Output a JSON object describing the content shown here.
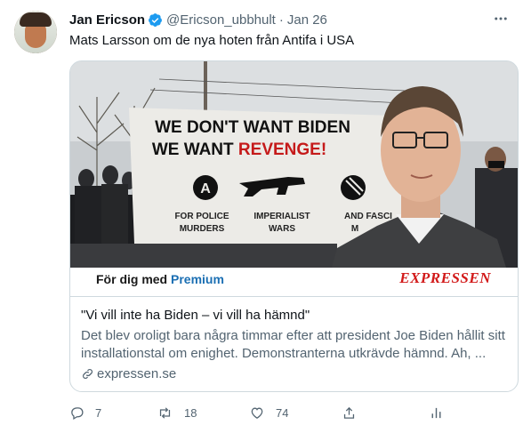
{
  "author": {
    "name": "Jan Ericson",
    "handle": "@Ericson_ubbhult",
    "separator": "·",
    "time": "Jan 26"
  },
  "tweet": {
    "text": "Mats Larsson om de nya hoten från Antifa i USA"
  },
  "card": {
    "image": {
      "banner_line1": "WE DON'T WANT BIDEN",
      "banner_line2_prefix": "WE WANT ",
      "banner_line2_highlight": "REVENGE!",
      "banner_col1_a": "FOR POLICE",
      "banner_col1_b": "MURDERS",
      "banner_col2_a": "IMPERIALIST",
      "banner_col2_b": "WARS",
      "banner_col3_a": "AND FASCI",
      "banner_col3_b": "M"
    },
    "premium_prefix": "För dig med ",
    "premium_word": "Premium",
    "brand": "EXPRESSEN",
    "title": "\"Vi vill inte ha Biden – vi vill ha hämnd\"",
    "description": "Det blev oroligt bara några timmar efter att president Joe Biden hållit sitt installationstal om enighet. Demonstranterna utkrävde hämnd. Ah, ...",
    "domain": "expressen.se"
  },
  "actions": {
    "replies": "7",
    "retweets": "18",
    "likes": "74"
  },
  "colors": {
    "accent": "#1d9bf0",
    "secondary_text": "#536471",
    "border": "#cfd9de",
    "brand_red": "#d21a1a",
    "premium_blue": "#1b6fb3"
  },
  "icons": [
    "verified-badge-icon",
    "more-icon",
    "link-icon",
    "reply-icon",
    "retweet-icon",
    "like-icon",
    "share-icon",
    "analytics-icon"
  ]
}
